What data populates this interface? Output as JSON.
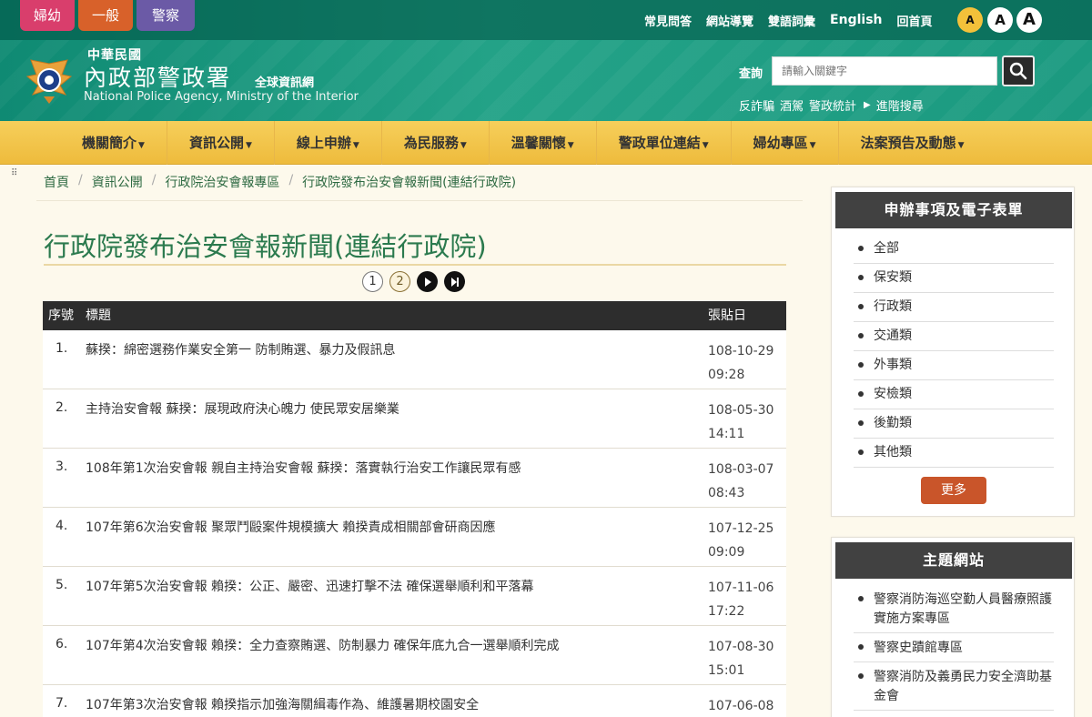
{
  "topbar": {
    "role_tabs": [
      "婦幼",
      "一般",
      "警察"
    ],
    "links": [
      "常見問答",
      "網站導覽",
      "雙語詞彙",
      "English",
      "回首頁"
    ],
    "font_sizes": [
      "A",
      "A",
      "A"
    ]
  },
  "logo": {
    "cn_top": "中華民國",
    "cn_main": "內政部警政署",
    "cn_sub": "全球資訊網",
    "en": "National Police Agency, Ministry of the Interior"
  },
  "search": {
    "label": "查詢",
    "placeholder": "請輸入關鍵字",
    "quick_links": [
      "反詐騙",
      "酒駕",
      "警政統計"
    ],
    "advanced": "進階搜尋"
  },
  "nav": [
    "機關簡介",
    "資訊公開",
    "線上申辦",
    "為民服務",
    "溫馨關懷",
    "警政單位連結",
    "婦幼專區",
    "法案預告及動態"
  ],
  "breadcrumb": [
    "首頁",
    "資訊公開",
    "行政院治安會報專區",
    "行政院發布治安會報新聞(連結行政院)"
  ],
  "page_title": "行政院發布治安會報新聞(連結行政院)",
  "pager": {
    "pages": [
      "1",
      "2"
    ],
    "current": "2"
  },
  "table": {
    "headers": {
      "no": "序號",
      "title": "標題",
      "date": "張貼日"
    },
    "rows": [
      {
        "no": "1.",
        "title": "蘇揆：綿密選務作業安全第一 防制賄選、暴力及假訊息",
        "date": "108-10-29",
        "time": "09:28"
      },
      {
        "no": "2.",
        "title": "主持治安會報 蘇揆：展現政府決心魄力 使民眾安居樂業",
        "date": "108-05-30",
        "time": "14:11"
      },
      {
        "no": "3.",
        "title": "108年第1次治安會報 親自主持治安會報 蘇揆：落實執行治安工作讓民眾有感",
        "date": "108-03-07",
        "time": "08:43"
      },
      {
        "no": "4.",
        "title": "107年第6次治安會報 聚眾鬥毆案件規模擴大 賴揆責成相關部會研商因應",
        "date": "107-12-25",
        "time": "09:09"
      },
      {
        "no": "5.",
        "title": "107年第5次治安會報 賴揆：公正、嚴密、迅速打擊不法 確保選舉順利和平落幕",
        "date": "107-11-06",
        "time": "17:22"
      },
      {
        "no": "6.",
        "title": "107年第4次治安會報 賴揆：全力查察賄選、防制暴力 確保年底九合一選舉順利完成",
        "date": "107-08-30",
        "time": "15:01"
      },
      {
        "no": "7.",
        "title": "107年第3次治安會報 賴揆指示加強海關緝毒作為、維護暑期校園安全",
        "date": "107-06-08",
        "time": ""
      }
    ]
  },
  "sidebar": {
    "categories": {
      "title": "申辦事項及電子表單",
      "items": [
        "全部",
        "保安類",
        "行政類",
        "交通類",
        "外事類",
        "安檢類",
        "後勤類",
        "其他類"
      ],
      "more": "更多"
    },
    "themes": {
      "title": "主題網站",
      "items": [
        "警察消防海巡空勤人員醫療照護實施方案專區",
        "警察史蹟館專區",
        "警察消防及義勇民力安全濟助基金會"
      ]
    }
  },
  "colors": {
    "header_green": "#1b9a80",
    "nav_gold": "#eebb3c",
    "title_green": "#2b7a4e",
    "more_orange": "#c9552a"
  }
}
